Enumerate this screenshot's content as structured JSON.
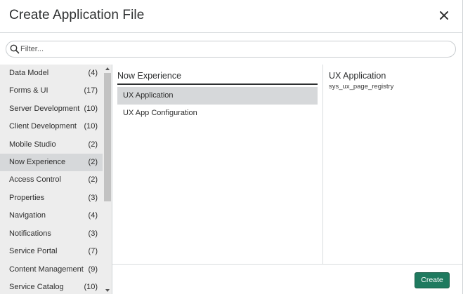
{
  "dialog": {
    "title": "Create Application File",
    "close_icon": "close-icon"
  },
  "filter": {
    "placeholder": "Filter...",
    "value": "",
    "icon": "search-icon"
  },
  "categories": [
    {
      "label": "Data Model",
      "count": "(4)"
    },
    {
      "label": "Forms & UI",
      "count": "(17)"
    },
    {
      "label": "Server Development",
      "count": "(10)"
    },
    {
      "label": "Client Development",
      "count": "(10)"
    },
    {
      "label": "Mobile Studio",
      "count": "(2)"
    },
    {
      "label": "Now Experience",
      "count": "(2)",
      "selected": true
    },
    {
      "label": "Access Control",
      "count": "(2)"
    },
    {
      "label": "Properties",
      "count": "(3)"
    },
    {
      "label": "Navigation",
      "count": "(4)"
    },
    {
      "label": "Notifications",
      "count": "(3)"
    },
    {
      "label": "Service Portal",
      "count": "(7)"
    },
    {
      "label": "Content Management",
      "count": "(9)"
    },
    {
      "label": "Service Catalog",
      "count": "(10)"
    }
  ],
  "file_types": {
    "heading": "Now Experience",
    "items": [
      {
        "label": "UX Application",
        "selected": true
      },
      {
        "label": "UX App Configuration"
      }
    ]
  },
  "details": {
    "heading": "UX Application",
    "table_name": "sys_ux_page_registry"
  },
  "footer": {
    "create_label": "Create"
  },
  "colors": {
    "primary_button": "#1f7a5f",
    "selected_row": "#d6d8da",
    "sidebar_bg": "#ededed"
  }
}
